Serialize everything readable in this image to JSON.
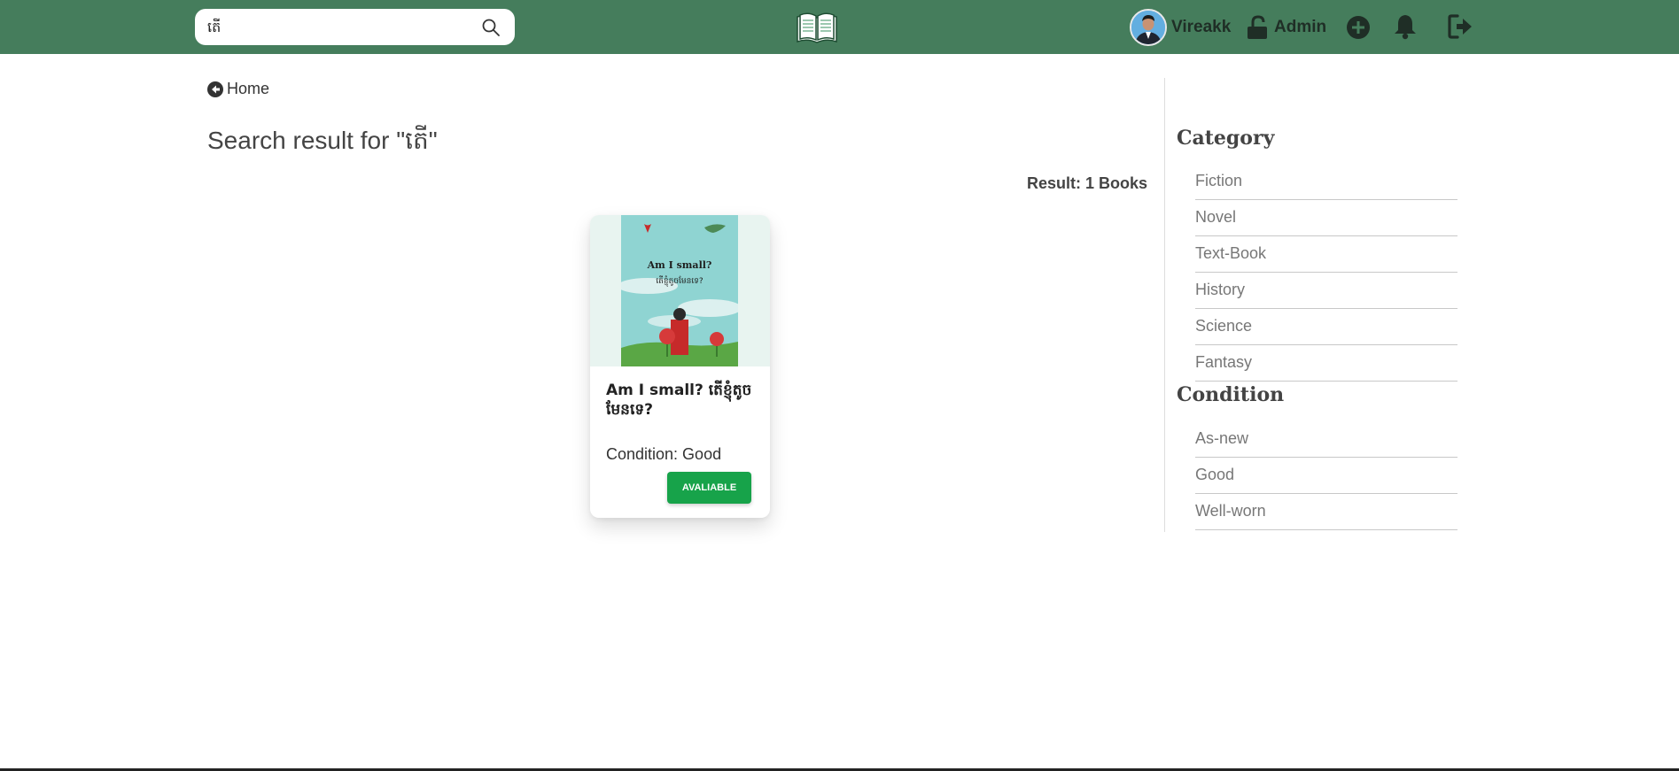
{
  "navbar": {
    "search": {
      "value": "តើ",
      "placeholder": ""
    },
    "user": {
      "name": "Vireakk"
    },
    "admin": {
      "label": "Admin"
    },
    "colors": {
      "background": "#457d5c"
    }
  },
  "breadcrumb": {
    "back_label": "Home"
  },
  "search_results": {
    "title": "Search result for \"តើ\"",
    "count_label": "Result: 1 Books",
    "books": [
      {
        "title": "Am I small? តើខ្ញុំតូចមែនទេ?",
        "cover": {
          "title_en": "Am I small?",
          "title_km": "តើខ្ញុំតូចមែនទេ?"
        },
        "condition": "Condition: Good",
        "status": "AVALIABLE"
      }
    ]
  },
  "sidebar": {
    "category_heading": "Category",
    "categories": [
      "Fiction",
      "Novel",
      "Text-Book",
      "History",
      "Science",
      "Fantasy"
    ],
    "condition_heading": "Condition",
    "conditions": [
      "As-new",
      "Good",
      "Well-worn"
    ]
  },
  "colors": {
    "accent": "#17a34a"
  }
}
